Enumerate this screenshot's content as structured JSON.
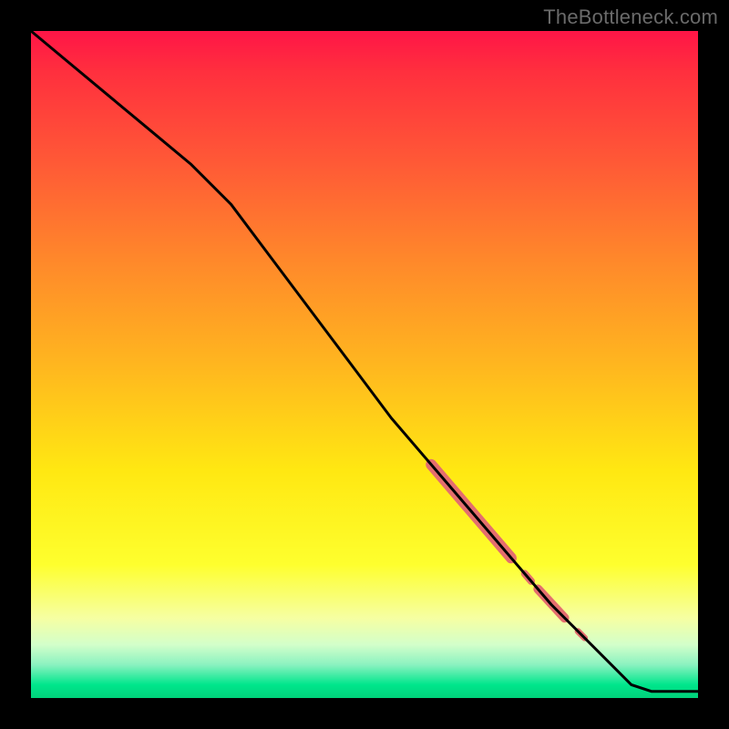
{
  "watermark": "TheBottleneck.com",
  "colors": {
    "curve": "#000000",
    "highlight": "#e46e6e",
    "frame": "#000000"
  },
  "chart_data": {
    "type": "line",
    "title": "",
    "xlabel": "",
    "ylabel": "",
    "xlim": [
      0,
      100
    ],
    "ylim": [
      0,
      100
    ],
    "grid": false,
    "series": [
      {
        "name": "curve",
        "x": [
          0,
          6,
          12,
          18,
          24,
          30,
          36,
          42,
          48,
          54,
          60,
          66,
          72,
          78,
          84,
          90,
          93,
          100
        ],
        "y": [
          100,
          95,
          90,
          85,
          80,
          74,
          66,
          58,
          50,
          42,
          35,
          28,
          21,
          14,
          8,
          2,
          1,
          1
        ]
      }
    ],
    "highlights": [
      {
        "name": "thick-segment",
        "x_start": 60,
        "x_end": 72,
        "thickness": 12
      },
      {
        "name": "dot-1",
        "x_start": 74,
        "x_end": 75,
        "thickness": 8
      },
      {
        "name": "short-segment",
        "x_start": 76,
        "x_end": 80,
        "thickness": 10
      },
      {
        "name": "dot-2",
        "x_start": 82,
        "x_end": 83,
        "thickness": 7
      }
    ]
  }
}
